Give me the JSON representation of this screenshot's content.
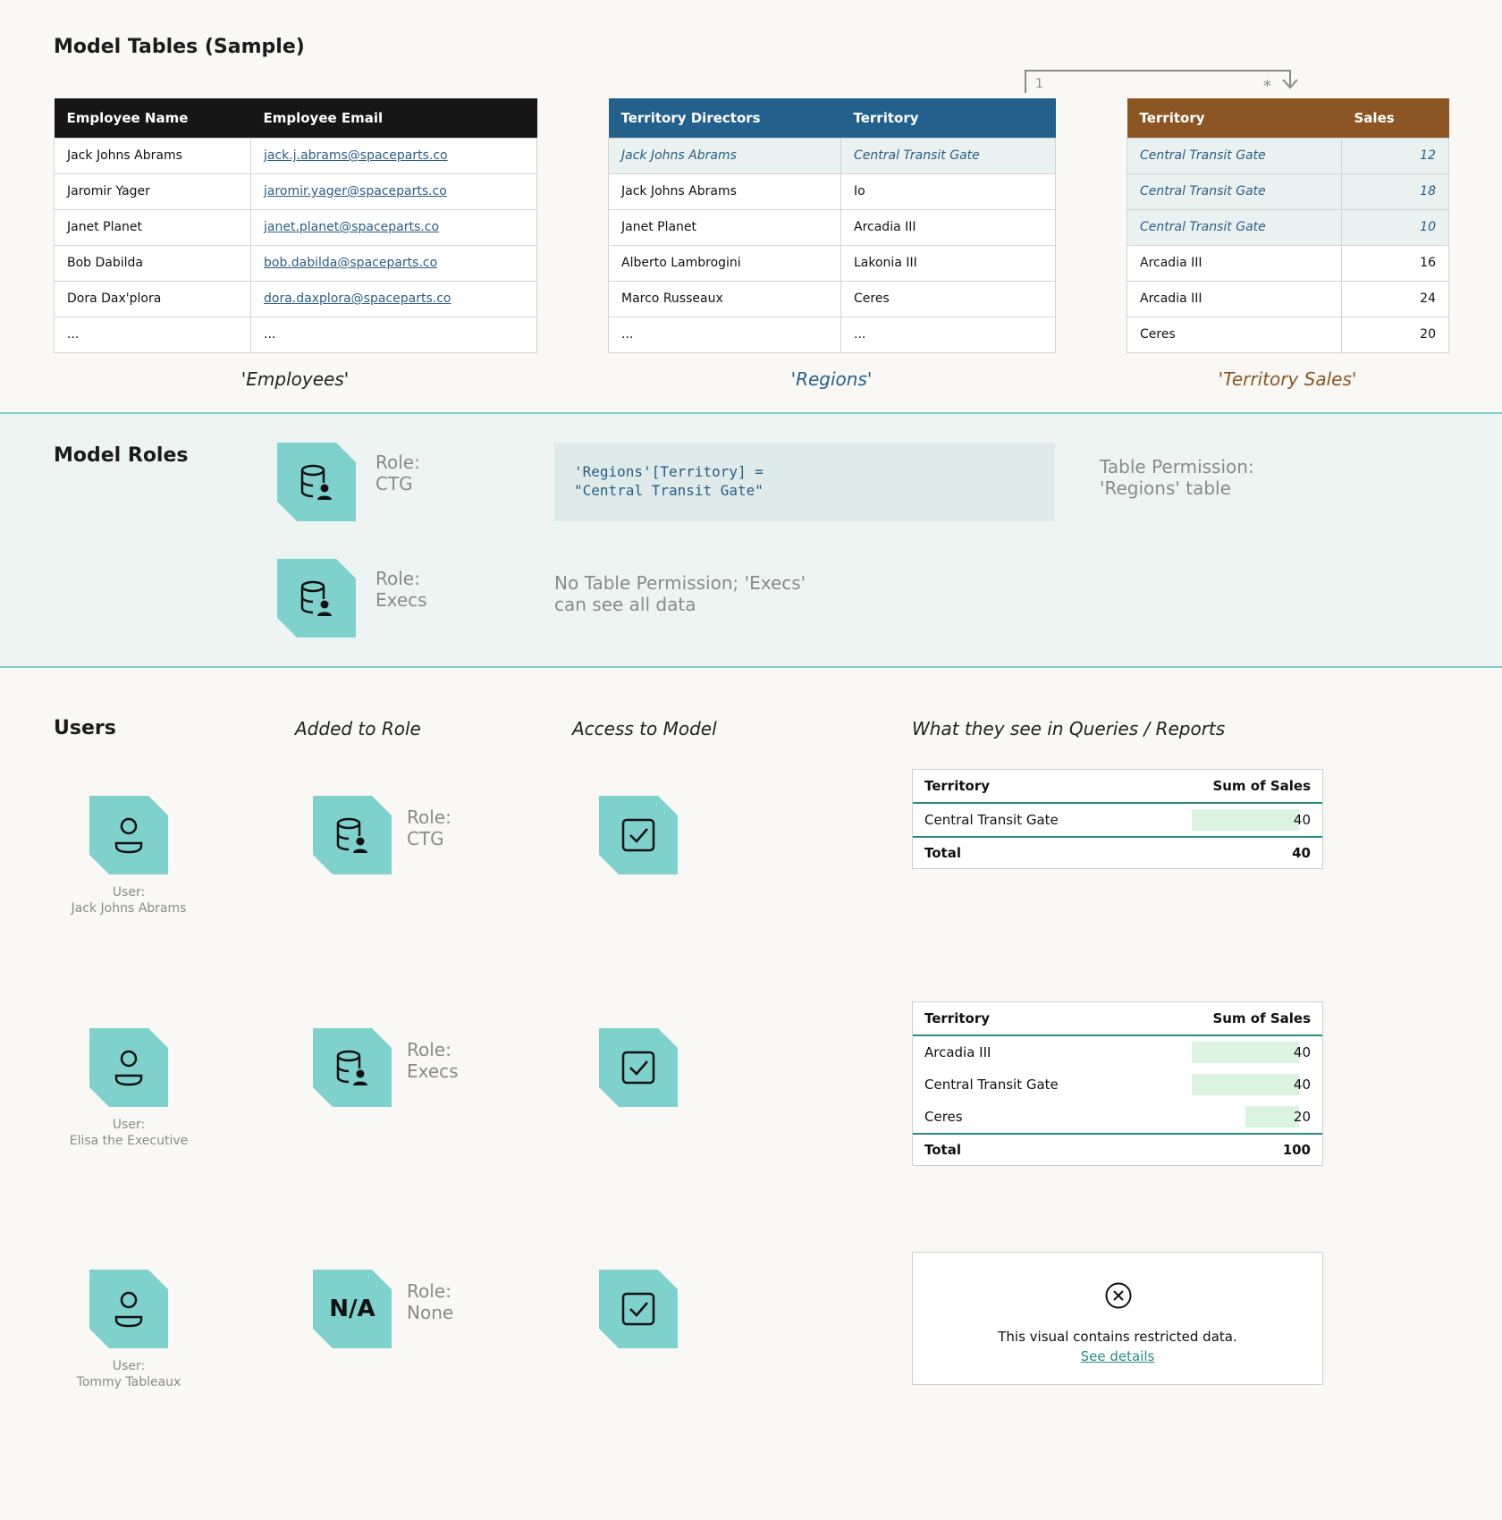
{
  "tables_section": {
    "title": "Model Tables (Sample)",
    "relationship": {
      "one": "1",
      "many": "*"
    },
    "employees": {
      "caption": "'Employees'",
      "headers": [
        "Employee Name",
        "Employee Email"
      ],
      "rows": [
        [
          "Jack Johns Abrams",
          "jack.j.abrams@spaceparts.co"
        ],
        [
          "Jaromir Yager",
          "jaromir.yager@spaceparts.co"
        ],
        [
          "Janet Planet",
          "janet.planet@spaceparts.co"
        ],
        [
          "Bob Dabilda",
          "bob.dabilda@spaceparts.co"
        ],
        [
          "Dora Dax'plora",
          "dora.daxplora@spaceparts.co"
        ],
        [
          "...",
          "..."
        ]
      ]
    },
    "regions": {
      "caption": "'Regions'",
      "headers": [
        "Territory Directors",
        "Territory"
      ],
      "rows": [
        [
          "Jack Johns Abrams",
          "Central Transit Gate"
        ],
        [
          "Jack Johns Abrams",
          "Io"
        ],
        [
          "Janet Planet",
          "Arcadia III"
        ],
        [
          "Alberto Lambrogini",
          "Lakonia III"
        ],
        [
          "Marco Russeaux",
          "Ceres"
        ],
        [
          "...",
          "..."
        ]
      ]
    },
    "sales": {
      "caption": "'Territory Sales'",
      "headers": [
        "Territory",
        "Sales"
      ],
      "rows": [
        [
          "Central Transit Gate",
          "12"
        ],
        [
          "Central Transit Gate",
          "18"
        ],
        [
          "Central Transit Gate",
          "10"
        ],
        [
          "Arcadia III",
          "16"
        ],
        [
          "Arcadia III",
          "24"
        ],
        [
          "Ceres",
          "20"
        ]
      ]
    }
  },
  "roles_section": {
    "title": "Model Roles",
    "roles": [
      {
        "label_1": "Role:",
        "label_2": "CTG"
      },
      {
        "label_1": "Role:",
        "label_2": "Execs"
      }
    ],
    "filter_line_1": "'Regions'[Territory] =",
    "filter_line_2": "\"Central Transit Gate\"",
    "permission_line_1": "Table Permission:",
    "permission_line_2": "'Regions' table",
    "no_permission_line_1": "No Table Permission; 'Execs'",
    "no_permission_line_2": "can see all data"
  },
  "users_section": {
    "title": "Users",
    "col_added": "Added to Role",
    "col_access": "Access to Model",
    "col_see": "What they see in Queries / Reports",
    "users": [
      {
        "label_1": "User:",
        "label_2": "Jack Johns Abrams",
        "role_1": "Role:",
        "role_2": "CTG"
      },
      {
        "label_1": "User:",
        "label_2": "Elisa the Executive",
        "role_1": "Role:",
        "role_2": "Execs"
      },
      {
        "label_1": "User:",
        "label_2": "Tommy Tableaux",
        "role_1": "Role:",
        "role_2": "None",
        "role_tile_text": "N/A"
      }
    ],
    "visual_1": {
      "headers": [
        "Territory",
        "Sum of Sales"
      ],
      "rows": [
        {
          "label": "Central Transit Gate",
          "value": 40
        }
      ],
      "total_label": "Total",
      "total_value": "40"
    },
    "visual_2": {
      "headers": [
        "Territory",
        "Sum of Sales"
      ],
      "rows": [
        {
          "label": "Arcadia III",
          "value": 40
        },
        {
          "label": "Central Transit Gate",
          "value": 40
        },
        {
          "label": "Ceres",
          "value": 20
        }
      ],
      "total_label": "Total",
      "total_value": "100"
    },
    "restricted": {
      "message": "This visual contains restricted data.",
      "link": "See details"
    }
  },
  "colors": {
    "employees_header": "#161616",
    "regions_header": "#23618c",
    "sales_header": "#8b5624",
    "teal_tile": "#7fd1cc"
  }
}
